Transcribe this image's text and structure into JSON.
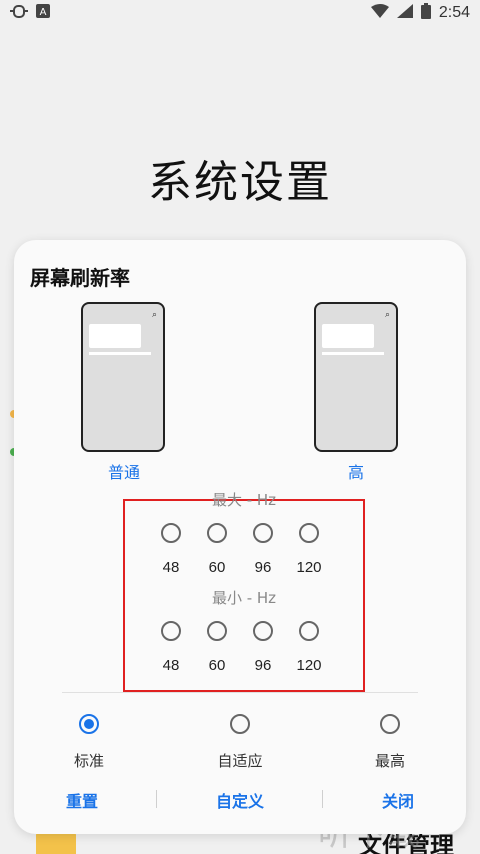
{
  "status_bar": {
    "time": "2:54",
    "left_icons": [
      "bug-icon",
      "a-box-icon"
    ],
    "right_icons": [
      "wifi-icon",
      "signal-icon",
      "battery-icon"
    ]
  },
  "background": {
    "title": "系统设置",
    "bottom_label": "文件管理",
    "watermark": "听下载"
  },
  "dialog": {
    "title": "屏幕刷新率",
    "phones": [
      {
        "label": "普通"
      },
      {
        "label": "高"
      }
    ],
    "max_hz": {
      "label": "最大 - Hz",
      "options": [
        "48",
        "60",
        "96",
        "120"
      ]
    },
    "min_hz": {
      "label": "最小 - Hz",
      "options": [
        "48",
        "60",
        "96",
        "120"
      ]
    },
    "modes": [
      {
        "label": "标准",
        "selected": true
      },
      {
        "label": "自适应",
        "selected": false
      },
      {
        "label": "最高",
        "selected": false
      }
    ],
    "buttons": {
      "reset": "重置",
      "custom": "自定义",
      "close": "关闭"
    }
  },
  "colors": {
    "accent": "#1a73e8",
    "highlight_box": "#e02020"
  }
}
